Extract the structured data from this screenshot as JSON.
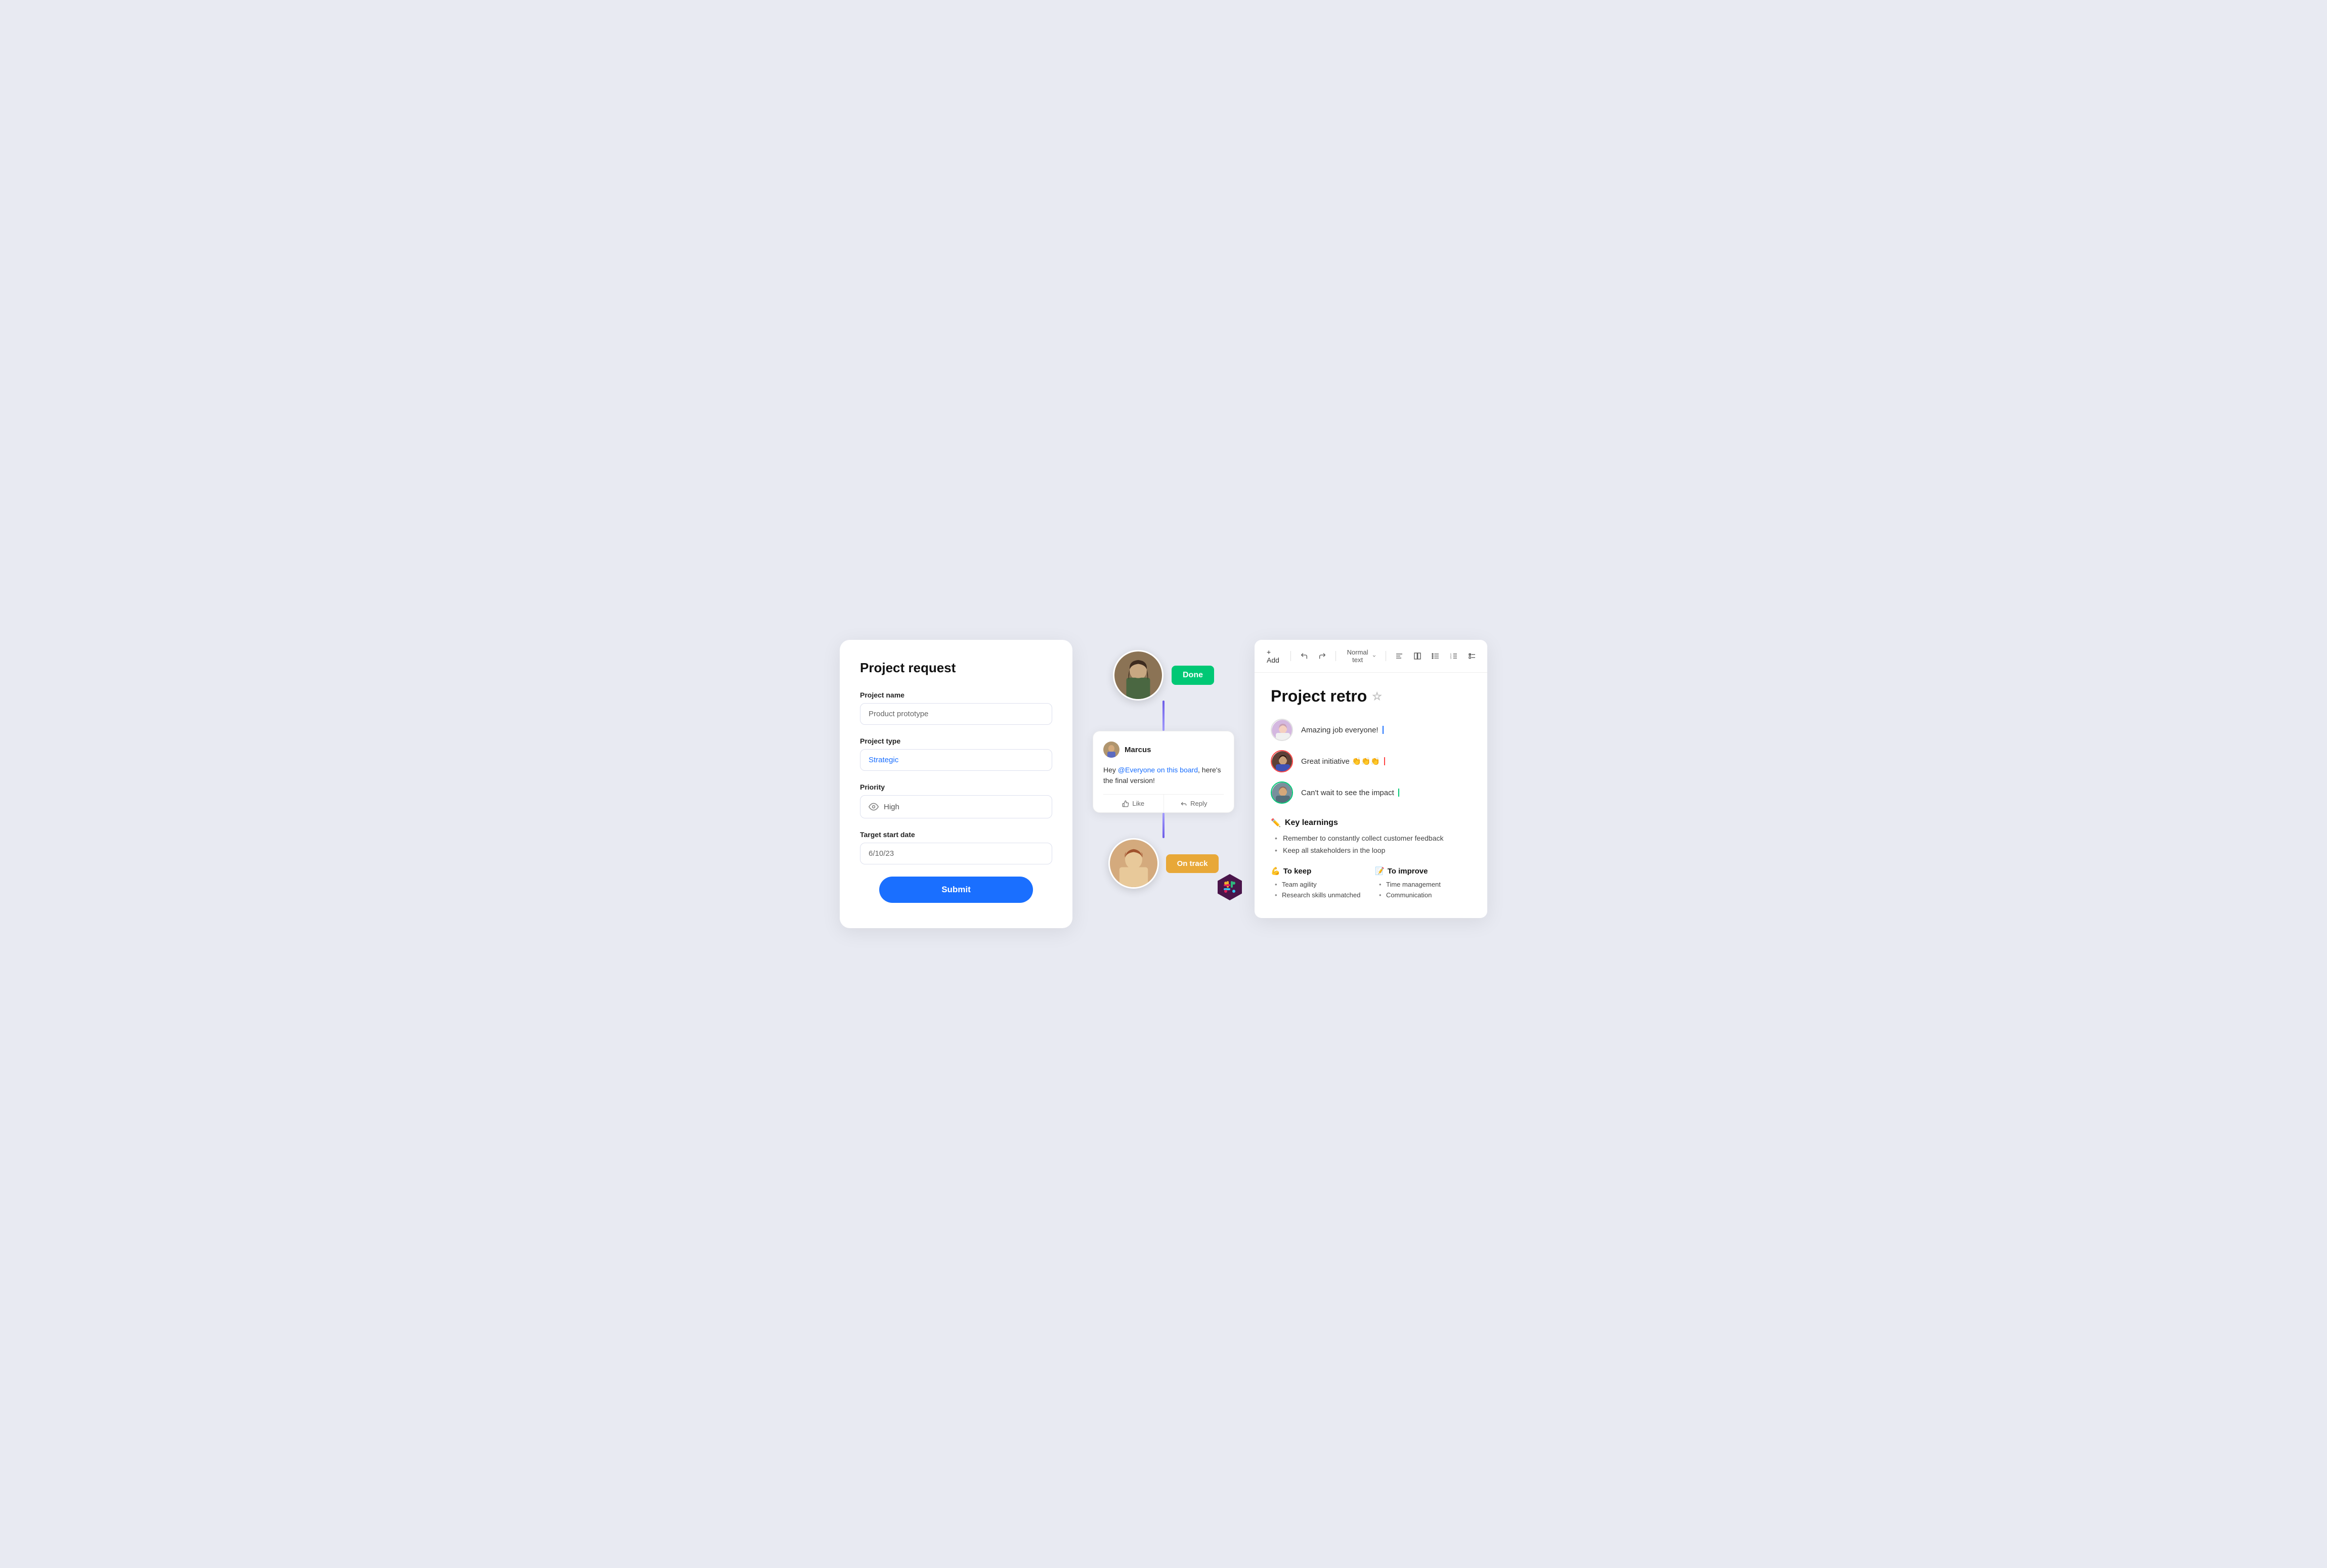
{
  "form": {
    "title": "Project request",
    "fields": {
      "project_name": {
        "label": "Project name",
        "value": "Product prototype"
      },
      "project_type": {
        "label": "Project type",
        "value": "Strategic"
      },
      "priority": {
        "label": "Priority",
        "value": "High"
      },
      "target_start_date": {
        "label": "Target start date",
        "value": "6/10/23"
      }
    },
    "submit_label": "Submit"
  },
  "workflow": {
    "person1_badge": "Done",
    "comment": {
      "author": "Marcus",
      "text_pre": "Hey ",
      "mention": "@Everyone on this board",
      "text_post": ", here's the final version!",
      "like_label": "Like",
      "reply_label": "Reply"
    },
    "person2_badge": "On track"
  },
  "retro": {
    "title": "Project retro",
    "toolbar": {
      "add_label": "+ Add",
      "text_format_label": "Normal text",
      "undo_label": "↩",
      "redo_label": "↪"
    },
    "comments": [
      {
        "text": "Amazing job everyone!",
        "cursor_color": "blue"
      },
      {
        "text": "Great initiative 👏👏👏",
        "cursor_color": "red"
      },
      {
        "text": "Can't wait to see the impact",
        "cursor_color": "green"
      }
    ],
    "key_learnings": {
      "heading": "Key learnings",
      "icon": "✏️",
      "items": [
        "Remember to constantly collect customer feedback",
        "Keep all stakeholders in the loop"
      ]
    },
    "to_keep": {
      "heading": "To keep",
      "icon": "💪",
      "items": [
        "Team agility",
        "Research skills unmatched"
      ]
    },
    "to_improve": {
      "heading": "To improve",
      "icon": "📝",
      "items": [
        "Time management",
        "Communication"
      ]
    }
  }
}
